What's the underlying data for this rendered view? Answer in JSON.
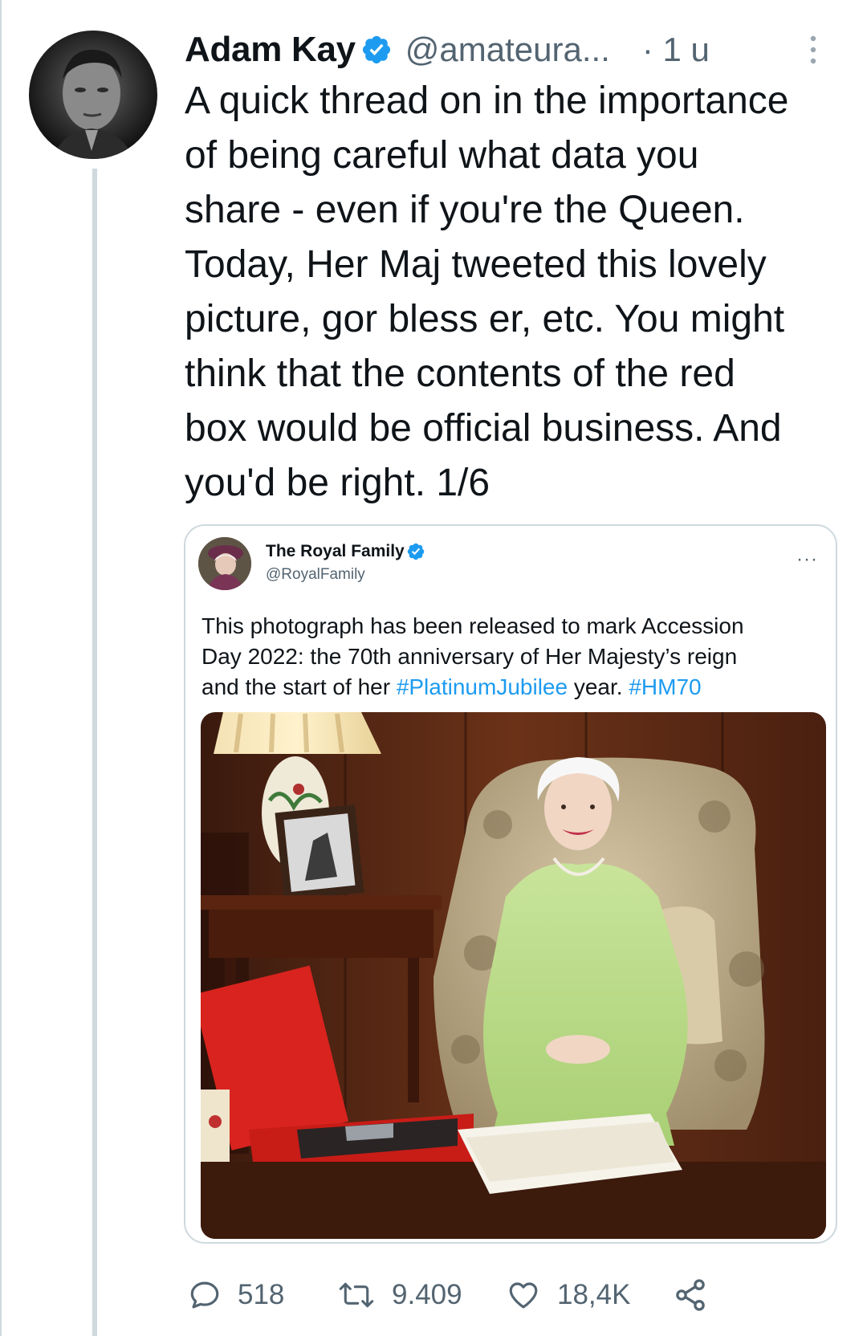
{
  "tweet": {
    "author_name": "Adam Kay",
    "handle": "@amateura...",
    "time": "· 1 u",
    "text_lines": [
      "A quick thread on in the importance",
      "of being careful what data you",
      "share - even if you're the Queen.",
      "Today, Her Maj tweeted this lovely",
      "picture, gor bless er, etc. You might",
      "think that the contents of the red",
      "box would be official business. And",
      "you'd be right. 1/6"
    ]
  },
  "quoted": {
    "author_name": "The Royal Family",
    "handle": "@RoyalFamily",
    "more": "···",
    "line1": "This photograph has been released to mark Accession",
    "line2": "Day 2022: the 70th anniversary of Her Majesty’s reign",
    "line3_prefix": "and the start of her ",
    "hashtag1": "#PlatinumJubilee",
    "line3_mid": " year. ",
    "hashtag2": "#HM70"
  },
  "actions": {
    "replies": "518",
    "retweets": "9.409",
    "likes": "18,4K"
  },
  "colors": {
    "verified": "#1d9bf0",
    "hashtag": "#1d9bf0",
    "secondary_text": "#536471",
    "border": "#cfd9de"
  },
  "icons": [
    "verified-badge-icon",
    "more-vertical-icon",
    "more-horizontal-icon",
    "reply-icon",
    "retweet-icon",
    "like-icon",
    "share-icon"
  ]
}
